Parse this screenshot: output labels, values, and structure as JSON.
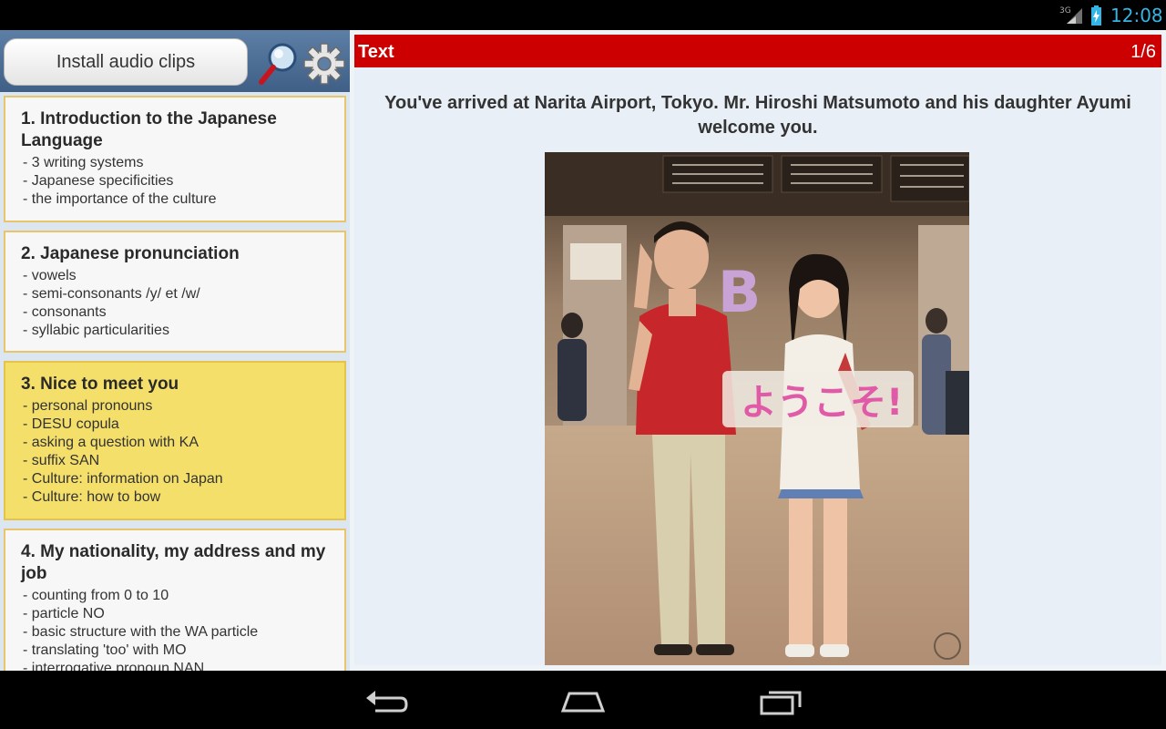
{
  "status_bar": {
    "network": "3G",
    "time": "12:08"
  },
  "toolbar": {
    "install_label": "Install audio clips",
    "search_icon": "magnifier-icon",
    "settings_icon": "gear-icon"
  },
  "lessons": [
    {
      "title": "1. Introduction to the Japanese Language",
      "topics": [
        "- 3 writing systems",
        "- Japanese specificities",
        "- the importance of the culture"
      ]
    },
    {
      "title": "2. Japanese pronunciation",
      "topics": [
        "- vowels",
        "- semi-consonants /y/ et /w/",
        "- consonants",
        "- syllabic particularities"
      ]
    },
    {
      "title": "3. Nice to meet you",
      "selected": true,
      "topics": [
        "- personal pronouns",
        "- DESU copula",
        "- asking a question with KA",
        "- suffix SAN",
        "- Culture: information on Japan",
        "- Culture: how to bow"
      ]
    },
    {
      "title": "4. My nationality, my address and my job",
      "topics": [
        "- counting from 0 to 10",
        "- particle NO",
        "- basic structure with the WA particle",
        "- translating 'too' with MO",
        "- interrogative pronoun NAN"
      ]
    }
  ],
  "content": {
    "section_title": "Text",
    "page": "1/6",
    "intro": "You've arrived at Narita Airport, Tokyo. Mr. Hiroshi Matsumoto and his daughter Ayumi welcome you.",
    "sign_text": "ようこそ!",
    "gate_letter": "B"
  },
  "nav": {
    "back_icon": "back-icon",
    "home_icon": "home-icon",
    "recents_icon": "recent-apps-icon"
  },
  "colors": {
    "accent_red": "#cc0000",
    "selected_lesson": "#f4df6b",
    "clock": "#33b5e5"
  }
}
